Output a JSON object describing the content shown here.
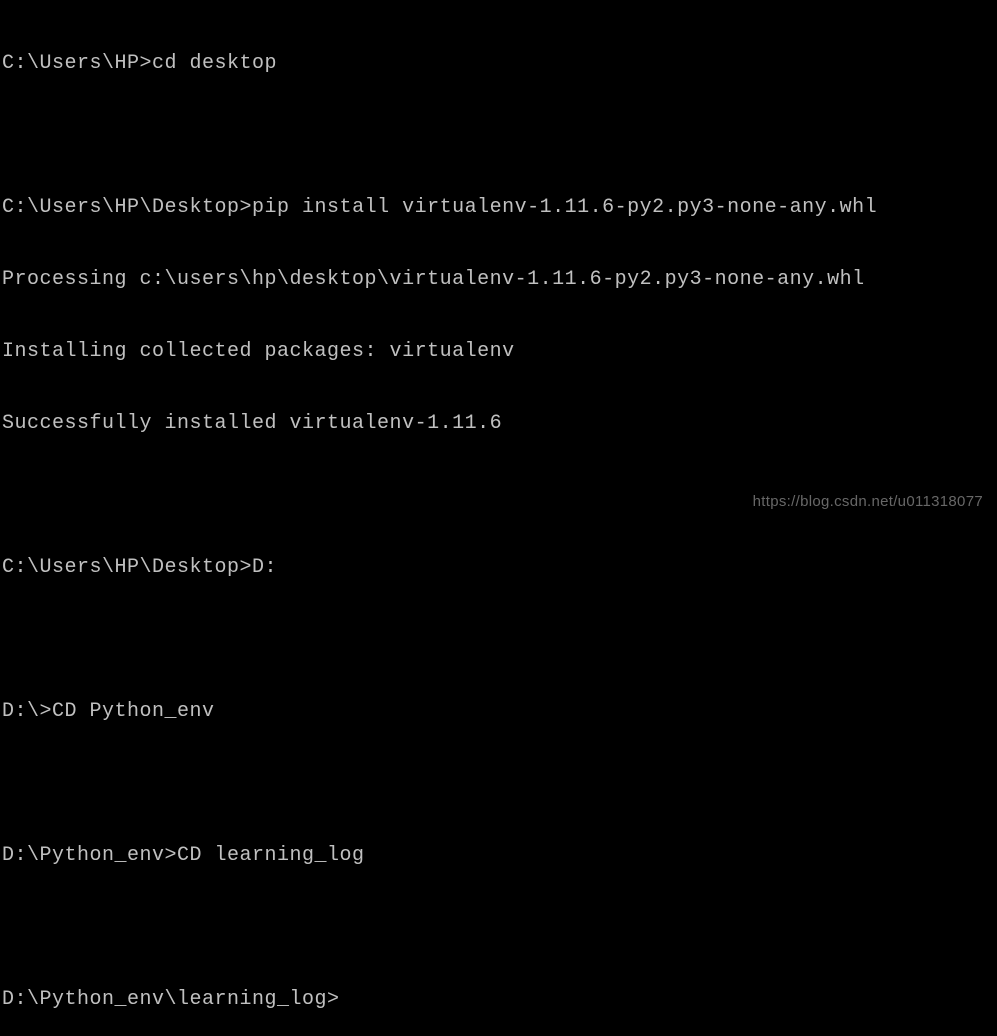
{
  "terminal": {
    "lines": [
      {
        "prompt": "C:\\Users\\HP>",
        "command": "cd desktop"
      },
      {
        "text": ""
      },
      {
        "prompt": "C:\\Users\\HP\\Desktop>",
        "command": "pip install virtualenv-1.11.6-py2.py3-none-any.whl"
      },
      {
        "text": "Processing c:\\users\\hp\\desktop\\virtualenv-1.11.6-py2.py3-none-any.whl"
      },
      {
        "text": "Installing collected packages: virtualenv"
      },
      {
        "text": "Successfully installed virtualenv-1.11.6"
      },
      {
        "text": ""
      },
      {
        "prompt": "C:\\Users\\HP\\Desktop>",
        "command": "D:"
      },
      {
        "text": ""
      },
      {
        "prompt": "D:\\>",
        "command": "CD Python_env"
      },
      {
        "text": ""
      },
      {
        "prompt": "D:\\Python_env>",
        "command": "CD learning_log"
      },
      {
        "text": ""
      },
      {
        "prompt": "D:\\Python_env\\learning_log>",
        "command": ""
      }
    ]
  },
  "watermark": "https://blog.csdn.net/u011318077"
}
